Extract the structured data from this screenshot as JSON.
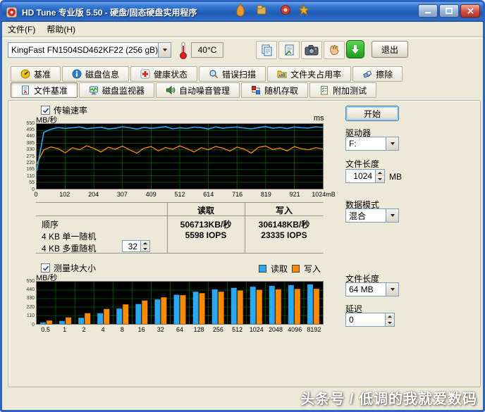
{
  "window": {
    "title": "HD Tune 专业版 5.50 - 硬盘/固态硬盘实用程序"
  },
  "menu": {
    "file": "文件(F)",
    "help": "帮助(H)"
  },
  "toolbar": {
    "drive": "KingFast FN1504SD462KF22  (256 gB)",
    "temp": "40°C",
    "exit": "退出"
  },
  "tabs": {
    "row1": [
      "基准",
      "磁盘信息",
      "健康状态",
      "错误扫描",
      "文件夹占用率",
      "擦除"
    ],
    "row2": [
      "文件基准",
      "磁盘监视器",
      "自动噪音管理",
      "随机存取",
      "附加测试"
    ],
    "active": "文件基准"
  },
  "panel": {
    "transfer_checkbox": "传输速率",
    "unit_left": "MB/秒",
    "unit_right": "ms",
    "start": "开始",
    "drive_label": "驱动器",
    "drive_value": "F:",
    "filelen_label": "文件长度",
    "filelen_value": "1024",
    "filelen_unit": "MB",
    "datamode_label": "数据模式",
    "datamode_value": "混合",
    "table": {
      "read_header": "读取",
      "write_header": "写入",
      "rows": [
        {
          "label": "顺序",
          "read": "506713KB/秒",
          "write": "306148KB/秒"
        },
        {
          "label": "4 KB 单一随机",
          "read": "5598 IOPS",
          "write": "23335 IOPS"
        },
        {
          "label": "4 KB 多重随机",
          "spinner": "32",
          "read": "",
          "write": ""
        }
      ]
    },
    "block_checkbox": "测量块大小",
    "legend": {
      "read": "读取",
      "write": "写入"
    },
    "unit_left2": "MB/秒",
    "filelen2_label": "文件长度",
    "filelen2_value": "64 MB",
    "delay_label": "延迟",
    "delay_value": "0"
  },
  "watermark": "头条号 / 低调的我就爱数码",
  "colors": {
    "read": "#2aa8f0",
    "write": "#ff8a00",
    "grid": "#006000"
  },
  "icons": {
    "titlebar": "hdtune-app-icon",
    "toolbar": [
      "thermometer-icon",
      "copy-pages-icon",
      "copy-report-icon",
      "camera-icon",
      "hand-icon",
      "download-arrow-icon"
    ],
    "tabs_row1": [
      "benchmark-icon",
      "disk-info-icon",
      "health-icon",
      "error-scan-icon",
      "folder-usage-icon",
      "erase-icon"
    ],
    "tabs_row2": [
      "file-benchmark-icon",
      "disk-monitor-icon",
      "aam-icon",
      "random-access-icon",
      "extra-tests-icon"
    ]
  },
  "chart_data": [
    {
      "type": "line",
      "title": "传输速率",
      "ylabel": "MB/秒",
      "ylabel_right": "ms",
      "ylim": [
        0,
        550
      ],
      "y_divisions": 10,
      "x_ticks": [
        "0",
        "102",
        "204",
        "307",
        "409",
        "512",
        "614",
        "716",
        "819",
        "921",
        "1024mB"
      ],
      "series": [
        {
          "name": "读取",
          "values": [
            150,
            480,
            505,
            520,
            512,
            518,
            525,
            510,
            516,
            522,
            508,
            514,
            526,
            518,
            506,
            521,
            513,
            519,
            527,
            509,
            517,
            512,
            523,
            519,
            507,
            525,
            514,
            520,
            524,
            515,
            509,
            519,
            528,
            514,
            521,
            511,
            524,
            518,
            515,
            526,
            520
          ]
        },
        {
          "name": "写入",
          "values": [
            210,
            330,
            355,
            340,
            305,
            348,
            332,
            365,
            342,
            312,
            352,
            336,
            362,
            330,
            302,
            344,
            358,
            322,
            350,
            336,
            364,
            341,
            312,
            349,
            331,
            359,
            345,
            320,
            354,
            337,
            303,
            351,
            363,
            333,
            346,
            321,
            358,
            340,
            331,
            349,
            338
          ]
        }
      ]
    },
    {
      "type": "bar",
      "title": "测量块大小",
      "ylabel": "MB/秒",
      "ylim": [
        0,
        550
      ],
      "y_divisions": 5,
      "categories": [
        "0.5",
        "1",
        "2",
        "4",
        "8",
        "16",
        "32",
        "64",
        "128",
        "256",
        "512",
        "1024",
        "2048",
        "4096",
        "8192"
      ],
      "series": [
        {
          "name": "读取",
          "values": [
            20,
            40,
            80,
            140,
            200,
            260,
            320,
            380,
            420,
            450,
            470,
            485,
            495,
            505,
            515
          ]
        },
        {
          "name": "写入",
          "values": [
            45,
            85,
            140,
            195,
            255,
            305,
            345,
            375,
            400,
            420,
            435,
            445,
            450,
            455,
            458
          ]
        }
      ],
      "legend_position": "top-right"
    }
  ]
}
